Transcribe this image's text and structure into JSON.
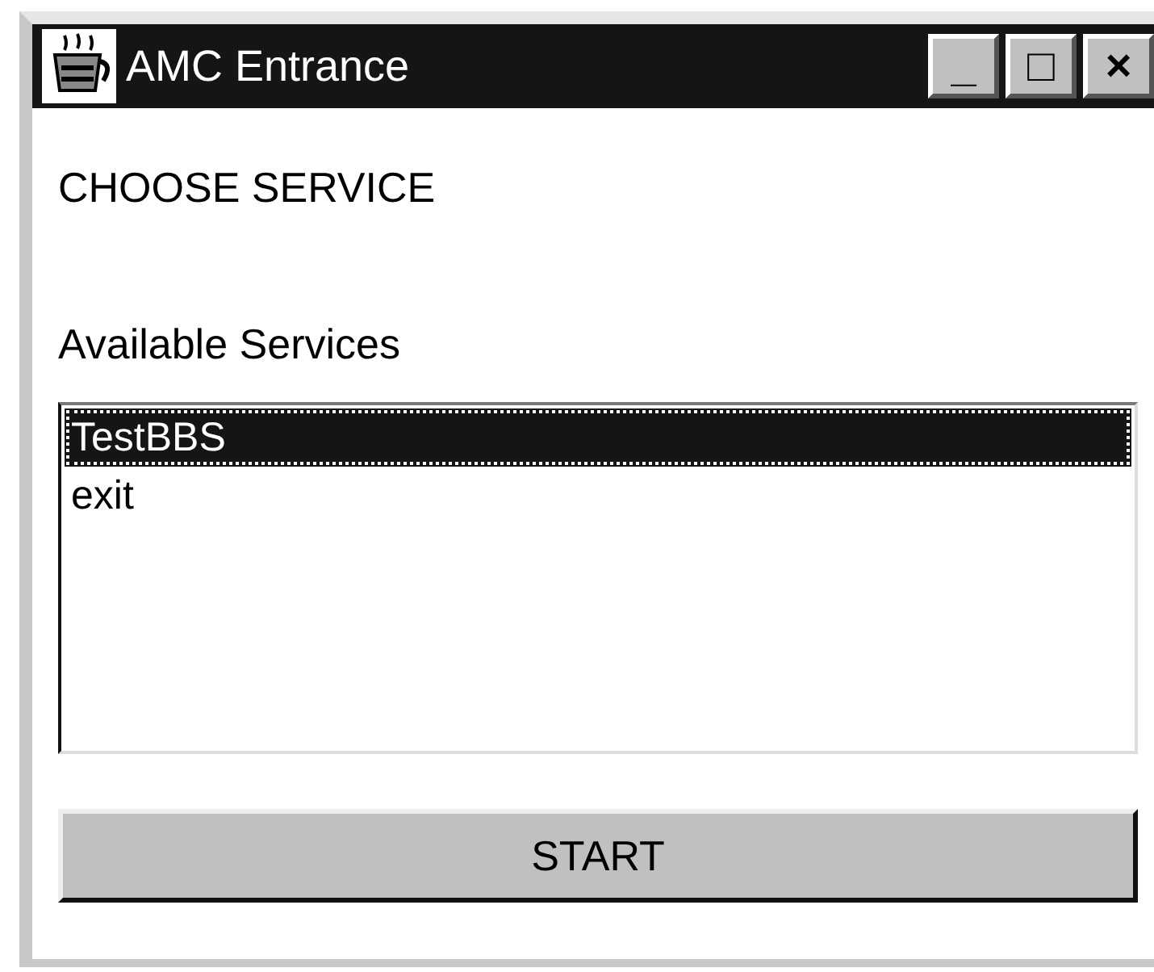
{
  "window": {
    "title": "AMC Entrance",
    "controls": [
      "_",
      "□",
      "×"
    ]
  },
  "heading": "CHOOSE SERVICE",
  "list_label": "Available Services",
  "services": [
    {
      "label": "TestBBS",
      "selected": true
    },
    {
      "label": "exit",
      "selected": false
    }
  ],
  "buttons": [
    "START"
  ]
}
